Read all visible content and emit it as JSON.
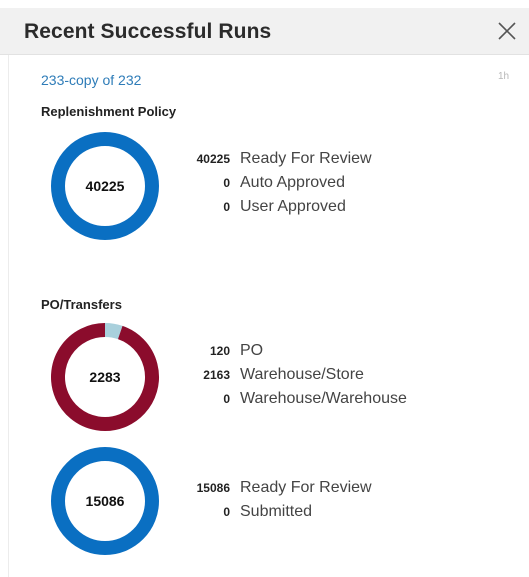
{
  "panel": {
    "title": "Recent Successful Runs",
    "close_icon": "close-icon"
  },
  "run": {
    "link_label": "233-copy of 232",
    "time_ago": "1h"
  },
  "sections": {
    "replenishment": {
      "title": "Replenishment Policy",
      "donut": {
        "center": "40225",
        "color": "#0a6fc2",
        "segments": [
          {
            "label": "Ready For Review",
            "count": "40225",
            "value": 40225,
            "color": "#0a6fc2"
          },
          {
            "label": "Auto Approved",
            "count": "0",
            "value": 0,
            "color": "#9fd0e0"
          },
          {
            "label": "User Approved",
            "count": "0",
            "value": 0,
            "color": "#8a0c2a"
          }
        ]
      }
    },
    "po_transfers": {
      "title": "PO/Transfers",
      "donut": {
        "center": "2283",
        "segments": [
          {
            "label": "PO",
            "count": "120",
            "value": 120,
            "color": "#a9d0dc"
          },
          {
            "label": "Warehouse/Store",
            "count": "2163",
            "value": 2163,
            "color": "#8b0c2c"
          },
          {
            "label": "Warehouse/Warehouse",
            "count": "0",
            "value": 0,
            "color": "#0a6fc2"
          }
        ]
      }
    },
    "third": {
      "donut": {
        "center": "15086",
        "segments": [
          {
            "label": "Ready For Review",
            "count": "15086",
            "value": 15086,
            "color": "#0a6fc2"
          },
          {
            "label": "Submitted",
            "count": "0",
            "value": 0,
            "color": "#9fd0e0"
          }
        ]
      }
    }
  }
}
